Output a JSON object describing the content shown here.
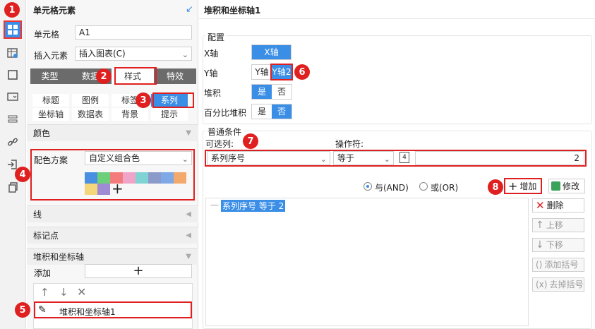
{
  "left_panel": {
    "title": "单元格元素",
    "cell_label": "单元格",
    "cell_value": "A1",
    "insert_label": "插入元素",
    "insert_value": "插入图表(C)",
    "tabs": [
      "类型",
      "数据",
      "样式",
      "特效"
    ],
    "subtabs_row1": [
      "标题",
      "图例",
      "标签",
      "系列"
    ],
    "subtabs_row2": [
      "坐标轴",
      "数据表",
      "背景",
      "提示"
    ],
    "color_section": "颜色",
    "color_scheme_label": "配色方案",
    "color_scheme_value": "自定义组合色",
    "swatches": [
      "#4a90e2",
      "#6ccf7a",
      "#f47b7b",
      "#f0a5c8",
      "#7fd3d3",
      "#8c9ac9",
      "#7ea8e6",
      "#f2a96b",
      "#f4d77a",
      "#9f8ad4"
    ],
    "line_section": "线",
    "marker_section": "标记点",
    "stack_section": "堆积和坐标轴",
    "add_label": "添加",
    "list_item": "堆积和坐标轴1"
  },
  "right_panel": {
    "title": "堆积和坐标轴1",
    "config_legend": "配置",
    "x_axis_label": "X轴",
    "x_axis_value": "X轴",
    "y_axis_label": "Y轴",
    "y_axis_opt1": "Y轴",
    "y_axis_opt2": "Y轴2",
    "stack_label": "堆积",
    "stack_yes": "是",
    "stack_no": "否",
    "pct_stack_label": "百分比堆积",
    "pct_yes": "是",
    "pct_no": "否",
    "condition_legend": "普通条件",
    "column_label": "可选列:",
    "operator_label": "操作符:",
    "column_value": "系列序号",
    "operator_value": "等于",
    "condition_value": "2",
    "and_label": "与(AND)",
    "or_label": "或(OR)",
    "add_button": "增加",
    "modify_button": "修改",
    "condition_item": "系列序号 等于 2",
    "delete_button": "删除",
    "up_button": "上移",
    "down_button": "下移",
    "add_bracket_button": "添加括号",
    "remove_bracket_button": "去掉括号"
  },
  "badges": [
    "1",
    "2",
    "3",
    "4",
    "5",
    "6",
    "7",
    "8"
  ]
}
